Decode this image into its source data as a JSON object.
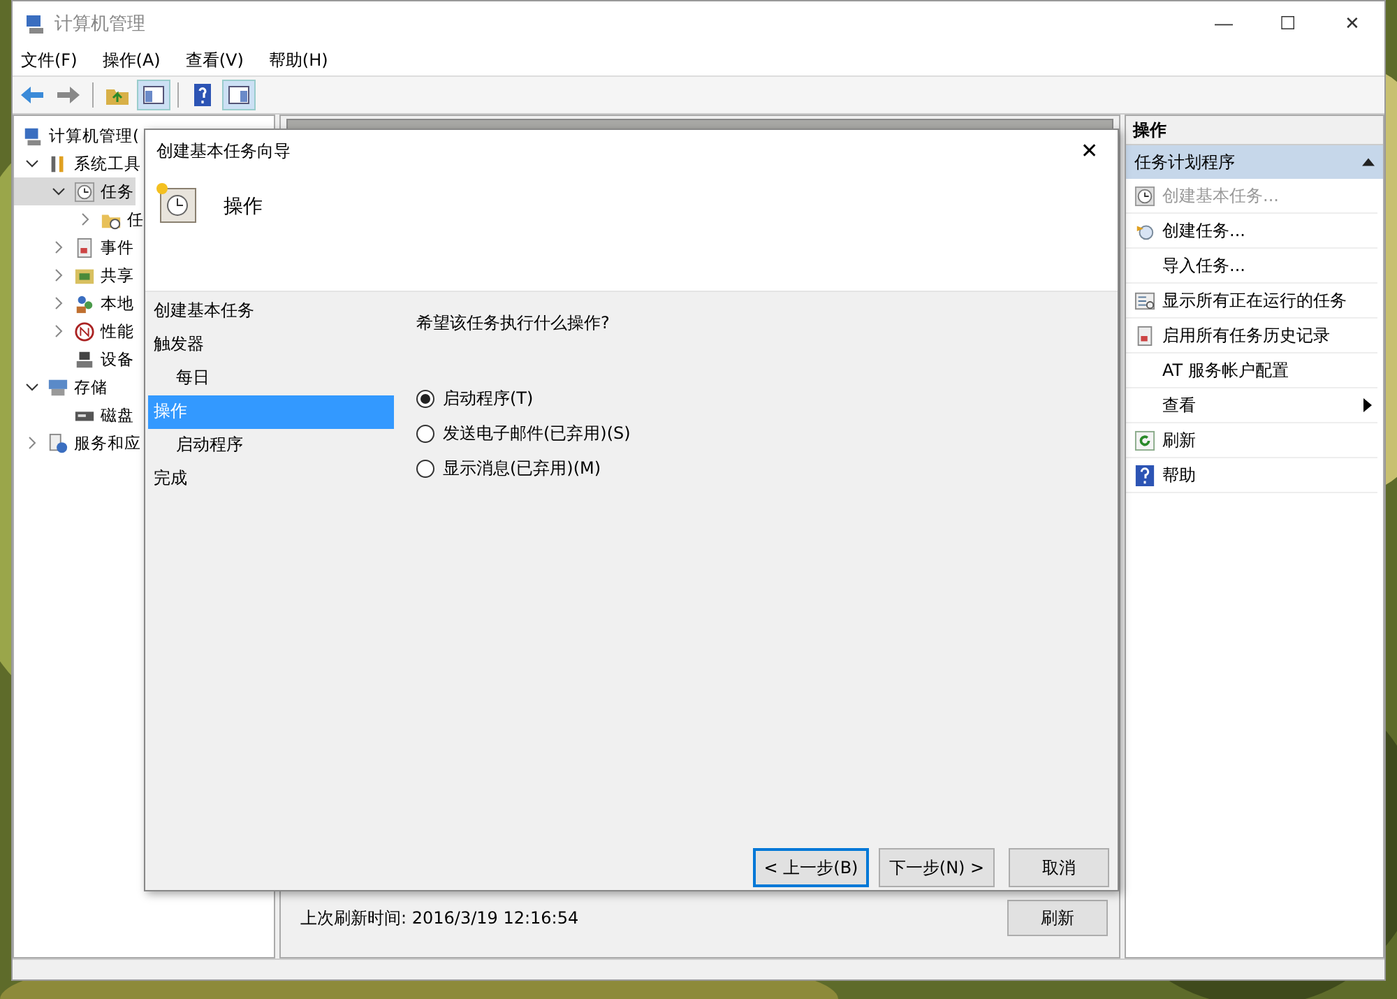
{
  "window": {
    "title": "计算机管理",
    "controls": [
      "—",
      "☐",
      "✕"
    ]
  },
  "menu": [
    "文件(F)",
    "操作(A)",
    "查看(V)",
    "帮助(H)"
  ],
  "tree": [
    {
      "label": "计算机管理(",
      "children": [
        {
          "label": "系统工具",
          "expanded": true,
          "children": [
            {
              "label": "任务",
              "expanded": true,
              "selected": true,
              "children": [
                {
                  "label": "任",
                  "expanded": false,
                  "selected": false
                }
              ]
            },
            {
              "label": "事件",
              "expanded": false,
              "selected": false
            },
            {
              "label": "共享",
              "expanded": false,
              "selected": false
            },
            {
              "label": "本地",
              "expanded": false,
              "selected": false
            },
            {
              "label": "性能",
              "expanded": false,
              "selected": false
            },
            {
              "label": "设备",
              "selected": false
            }
          ]
        },
        {
          "label": "存储",
          "expanded": true,
          "children": [
            {
              "label": "磁盘",
              "selected": false
            }
          ]
        },
        {
          "label": "服务和应",
          "expanded": false
        }
      ]
    }
  ],
  "center": {
    "last_refresh": "上次刷新时间: 2016/3/19 12:16:54",
    "refresh_button": "刷新"
  },
  "actions": {
    "title": "操作",
    "section": "任务计划程序",
    "expanded": true,
    "items": [
      {
        "label": "创建基本任务...",
        "disabled": true
      },
      {
        "label": "创建任务...",
        "disabled": false
      },
      {
        "label": "导入任务...",
        "disabled": false
      },
      {
        "label": "显示所有正在运行的任务",
        "disabled": false
      },
      {
        "label": "启用所有任务历史记录",
        "disabled": false
      },
      {
        "label": "AT 服务帐户配置",
        "disabled": false
      },
      {
        "label": "查看",
        "disabled": false,
        "submenu": true
      },
      {
        "label": "刷新",
        "disabled": false
      },
      {
        "label": "帮助",
        "disabled": false
      }
    ]
  },
  "dialog": {
    "title": "创建基本任务向导",
    "close": "✕",
    "heading": "操作",
    "steps": [
      {
        "label": "创建基本任务",
        "sub": false,
        "selected": false
      },
      {
        "label": "触发器",
        "sub": false,
        "selected": false
      },
      {
        "label": "每日",
        "sub": true,
        "selected": false
      },
      {
        "label": "操作",
        "sub": false,
        "selected": true
      },
      {
        "label": "启动程序",
        "sub": true,
        "selected": false
      },
      {
        "label": "完成",
        "sub": false,
        "selected": false
      }
    ],
    "question": "希望该任务执行什么操作?",
    "options": [
      {
        "label": "启动程序(T)",
        "selected": true
      },
      {
        "label": "发送电子邮件(已弃用)(S)",
        "selected": false
      },
      {
        "label": "显示消息(已弃用)(M)",
        "selected": false
      }
    ],
    "buttons": [
      {
        "label": "< 上一步(B)",
        "default": true
      },
      {
        "label": "下一步(N) >",
        "default": false
      },
      {
        "label": "取消",
        "default": false
      }
    ]
  }
}
